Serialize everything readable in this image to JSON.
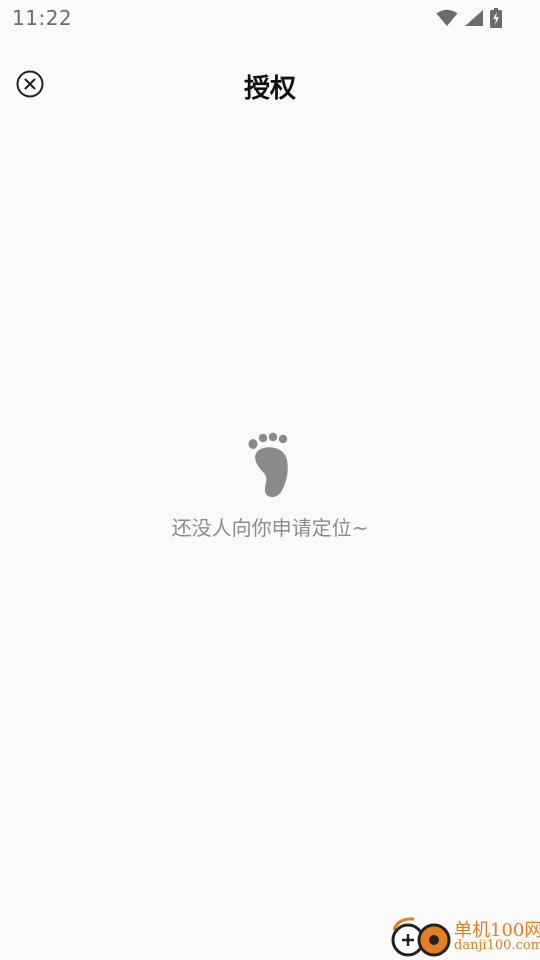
{
  "status_bar": {
    "time": "11:22",
    "icons": [
      "wifi-icon",
      "signal-icon",
      "battery-charging-icon"
    ]
  },
  "header": {
    "title": "授权",
    "close_icon": "close-circle-icon"
  },
  "empty_state": {
    "icon": "footprint-icon",
    "message": "还没人向你申请定位~"
  },
  "watermark": {
    "name": "单机100网",
    "domain": "danji100.com"
  },
  "colors": {
    "background": "#fafafa",
    "title": "#111111",
    "empty_text": "#8c8c8c",
    "icon_gray": "#8a8a8a",
    "watermark_orange": "#e67e22"
  }
}
